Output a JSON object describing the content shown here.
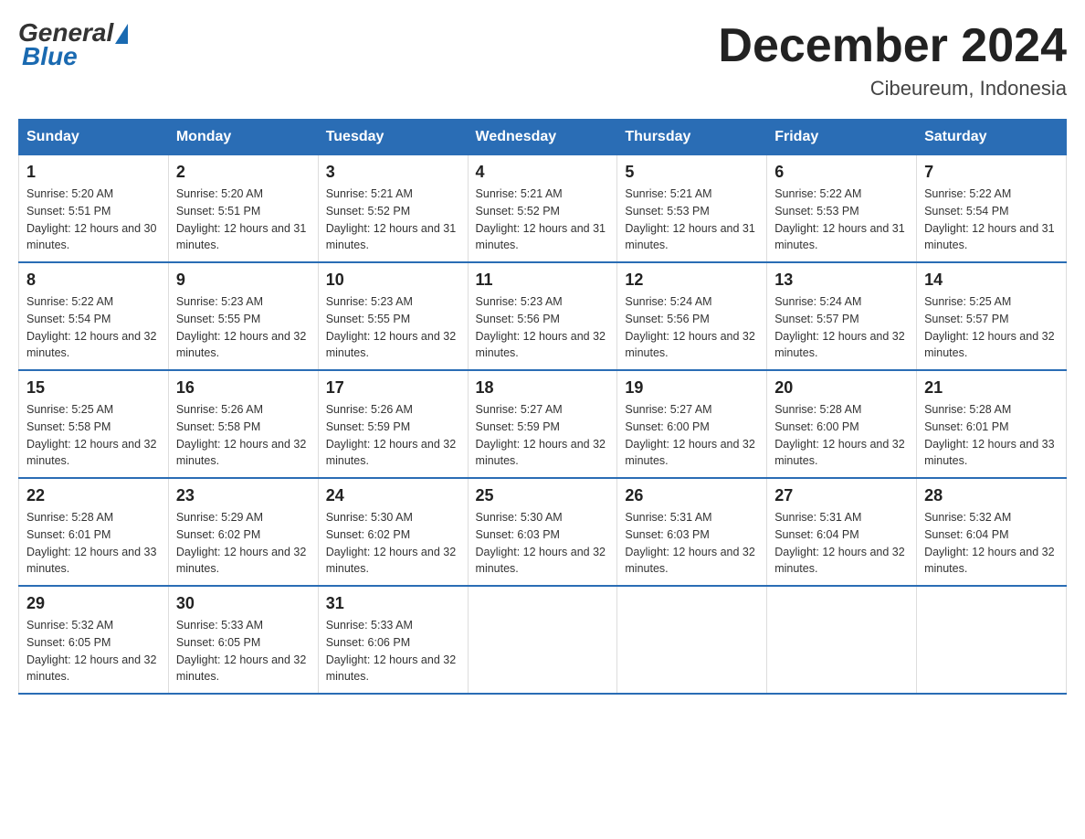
{
  "logo": {
    "general": "General",
    "blue": "Blue"
  },
  "title": "December 2024",
  "location": "Cibeureum, Indonesia",
  "days_header": [
    "Sunday",
    "Monday",
    "Tuesday",
    "Wednesday",
    "Thursday",
    "Friday",
    "Saturday"
  ],
  "weeks": [
    [
      {
        "day": "1",
        "sunrise": "5:20 AM",
        "sunset": "5:51 PM",
        "daylight": "12 hours and 30 minutes."
      },
      {
        "day": "2",
        "sunrise": "5:20 AM",
        "sunset": "5:51 PM",
        "daylight": "12 hours and 31 minutes."
      },
      {
        "day": "3",
        "sunrise": "5:21 AM",
        "sunset": "5:52 PM",
        "daylight": "12 hours and 31 minutes."
      },
      {
        "day": "4",
        "sunrise": "5:21 AM",
        "sunset": "5:52 PM",
        "daylight": "12 hours and 31 minutes."
      },
      {
        "day": "5",
        "sunrise": "5:21 AM",
        "sunset": "5:53 PM",
        "daylight": "12 hours and 31 minutes."
      },
      {
        "day": "6",
        "sunrise": "5:22 AM",
        "sunset": "5:53 PM",
        "daylight": "12 hours and 31 minutes."
      },
      {
        "day": "7",
        "sunrise": "5:22 AM",
        "sunset": "5:54 PM",
        "daylight": "12 hours and 31 minutes."
      }
    ],
    [
      {
        "day": "8",
        "sunrise": "5:22 AM",
        "sunset": "5:54 PM",
        "daylight": "12 hours and 32 minutes."
      },
      {
        "day": "9",
        "sunrise": "5:23 AM",
        "sunset": "5:55 PM",
        "daylight": "12 hours and 32 minutes."
      },
      {
        "day": "10",
        "sunrise": "5:23 AM",
        "sunset": "5:55 PM",
        "daylight": "12 hours and 32 minutes."
      },
      {
        "day": "11",
        "sunrise": "5:23 AM",
        "sunset": "5:56 PM",
        "daylight": "12 hours and 32 minutes."
      },
      {
        "day": "12",
        "sunrise": "5:24 AM",
        "sunset": "5:56 PM",
        "daylight": "12 hours and 32 minutes."
      },
      {
        "day": "13",
        "sunrise": "5:24 AM",
        "sunset": "5:57 PM",
        "daylight": "12 hours and 32 minutes."
      },
      {
        "day": "14",
        "sunrise": "5:25 AM",
        "sunset": "5:57 PM",
        "daylight": "12 hours and 32 minutes."
      }
    ],
    [
      {
        "day": "15",
        "sunrise": "5:25 AM",
        "sunset": "5:58 PM",
        "daylight": "12 hours and 32 minutes."
      },
      {
        "day": "16",
        "sunrise": "5:26 AM",
        "sunset": "5:58 PM",
        "daylight": "12 hours and 32 minutes."
      },
      {
        "day": "17",
        "sunrise": "5:26 AM",
        "sunset": "5:59 PM",
        "daylight": "12 hours and 32 minutes."
      },
      {
        "day": "18",
        "sunrise": "5:27 AM",
        "sunset": "5:59 PM",
        "daylight": "12 hours and 32 minutes."
      },
      {
        "day": "19",
        "sunrise": "5:27 AM",
        "sunset": "6:00 PM",
        "daylight": "12 hours and 32 minutes."
      },
      {
        "day": "20",
        "sunrise": "5:28 AM",
        "sunset": "6:00 PM",
        "daylight": "12 hours and 32 minutes."
      },
      {
        "day": "21",
        "sunrise": "5:28 AM",
        "sunset": "6:01 PM",
        "daylight": "12 hours and 33 minutes."
      }
    ],
    [
      {
        "day": "22",
        "sunrise": "5:28 AM",
        "sunset": "6:01 PM",
        "daylight": "12 hours and 33 minutes."
      },
      {
        "day": "23",
        "sunrise": "5:29 AM",
        "sunset": "6:02 PM",
        "daylight": "12 hours and 32 minutes."
      },
      {
        "day": "24",
        "sunrise": "5:30 AM",
        "sunset": "6:02 PM",
        "daylight": "12 hours and 32 minutes."
      },
      {
        "day": "25",
        "sunrise": "5:30 AM",
        "sunset": "6:03 PM",
        "daylight": "12 hours and 32 minutes."
      },
      {
        "day": "26",
        "sunrise": "5:31 AM",
        "sunset": "6:03 PM",
        "daylight": "12 hours and 32 minutes."
      },
      {
        "day": "27",
        "sunrise": "5:31 AM",
        "sunset": "6:04 PM",
        "daylight": "12 hours and 32 minutes."
      },
      {
        "day": "28",
        "sunrise": "5:32 AM",
        "sunset": "6:04 PM",
        "daylight": "12 hours and 32 minutes."
      }
    ],
    [
      {
        "day": "29",
        "sunrise": "5:32 AM",
        "sunset": "6:05 PM",
        "daylight": "12 hours and 32 minutes."
      },
      {
        "day": "30",
        "sunrise": "5:33 AM",
        "sunset": "6:05 PM",
        "daylight": "12 hours and 32 minutes."
      },
      {
        "day": "31",
        "sunrise": "5:33 AM",
        "sunset": "6:06 PM",
        "daylight": "12 hours and 32 minutes."
      },
      null,
      null,
      null,
      null
    ]
  ]
}
